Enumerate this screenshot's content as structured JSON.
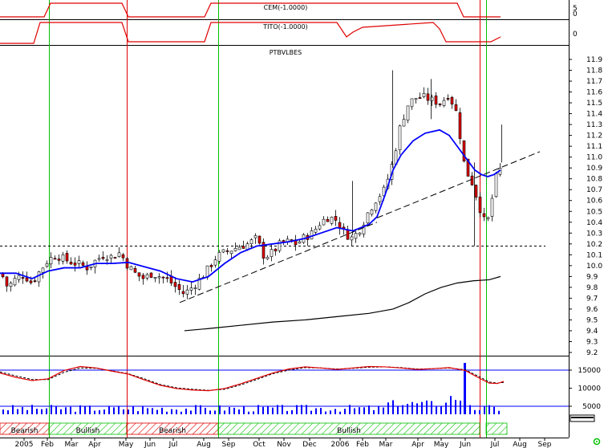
{
  "panels": {
    "cem_label": "CEM(-1.0000)",
    "tito_label": "TITO(-1.0000)",
    "price_label": "PTBVLBES",
    "cem_axis": [
      "5",
      "0"
    ],
    "tito_axis": [
      "0"
    ]
  },
  "zones": [
    {
      "label": "Bearish"
    },
    {
      "label": "Bullish"
    },
    {
      "label": "Bearish"
    },
    {
      "label": "Bullish"
    }
  ],
  "x_axis": {
    "months": [
      "2005",
      "Feb",
      "Mar",
      "Apr",
      "May",
      "Jun",
      "Jul",
      "Aug",
      "Sep",
      "Oct",
      "Nov",
      "Dec",
      "2006",
      "Feb",
      "Mar",
      "Apr",
      "May",
      "Jun",
      "Jul",
      "Aug",
      "Sep"
    ]
  },
  "colors": {
    "up_candle": "#ffffff",
    "down_candle": "#e00000",
    "ma_short": "#0000ff",
    "ma_long": "#000000",
    "bull_line": "#00c000",
    "bear_line": "#e00000",
    "volume": "#0000ff",
    "stoch_k": "#e00000",
    "stoch_d": "#000000",
    "status_icon": "#00c000"
  },
  "chart_data": {
    "type": "candlestick",
    "title": "PTBVLBES",
    "y_ticks": [
      "11.9",
      "11.8",
      "11.7",
      "11.6",
      "11.5",
      "11.4",
      "11.3",
      "11.2",
      "11.1",
      "11.0",
      "10.9",
      "10.8",
      "10.7",
      "10.6",
      "10.5",
      "10.4",
      "10.3",
      "10.2",
      "10.1",
      "10.0",
      "9.9",
      "9.8",
      "9.7",
      "9.6",
      "9.5",
      "9.4",
      "9.3",
      "9.2"
    ],
    "ylim": [
      9.15,
      11.95
    ],
    "volume_ticks": [
      "15000",
      "10000",
      "5000"
    ],
    "support_level": 10.18,
    "price_path": [
      [
        0,
        9.93
      ],
      [
        8,
        9.8
      ],
      [
        18,
        9.88
      ],
      [
        28,
        9.92
      ],
      [
        38,
        9.84
      ],
      [
        48,
        9.95
      ],
      [
        58,
        10.05
      ],
      [
        68,
        10.1
      ],
      [
        78,
        10.06
      ],
      [
        88,
        10.03
      ],
      [
        98,
        10.01
      ],
      [
        108,
        9.98
      ],
      [
        118,
        10.05
      ],
      [
        128,
        10.1
      ],
      [
        138,
        10.08
      ],
      [
        148,
        10.12
      ],
      [
        158,
        10.0
      ],
      [
        168,
        9.92
      ],
      [
        178,
        9.88
      ],
      [
        188,
        9.93
      ],
      [
        198,
        9.9
      ],
      [
        208,
        9.87
      ],
      [
        218,
        9.8
      ],
      [
        228,
        9.74
      ],
      [
        238,
        9.8
      ],
      [
        248,
        9.88
      ],
      [
        258,
        9.97
      ],
      [
        268,
        10.08
      ],
      [
        278,
        10.12
      ],
      [
        288,
        10.15
      ],
      [
        298,
        10.18
      ],
      [
        308,
        10.2
      ],
      [
        318,
        10.25
      ],
      [
        328,
        10.08
      ],
      [
        338,
        10.12
      ],
      [
        348,
        10.2
      ],
      [
        358,
        10.22
      ],
      [
        368,
        10.2
      ],
      [
        378,
        10.26
      ],
      [
        388,
        10.3
      ],
      [
        398,
        10.4
      ],
      [
        408,
        10.45
      ],
      [
        418,
        10.42
      ],
      [
        428,
        10.3
      ],
      [
        438,
        10.25
      ],
      [
        448,
        10.35
      ],
      [
        458,
        10.5
      ],
      [
        468,
        10.62
      ],
      [
        478,
        10.7
      ],
      [
        488,
        10.95
      ],
      [
        498,
        11.3
      ],
      [
        508,
        11.5
      ],
      [
        518,
        11.55
      ],
      [
        528,
        11.55
      ],
      [
        538,
        11.52
      ],
      [
        548,
        11.5
      ],
      [
        558,
        11.58
      ],
      [
        568,
        11.4
      ],
      [
        578,
        10.9
      ],
      [
        588,
        10.75
      ],
      [
        598,
        10.5
      ],
      [
        605,
        10.35
      ],
      [
        612,
        10.62
      ],
      [
        618,
        10.85
      ],
      [
        624,
        10.9
      ]
    ],
    "ma_short": [
      [
        0,
        9.93
      ],
      [
        20,
        9.93
      ],
      [
        40,
        9.88
      ],
      [
        60,
        9.95
      ],
      [
        80,
        9.98
      ],
      [
        100,
        9.98
      ],
      [
        120,
        10.02
      ],
      [
        140,
        10.02
      ],
      [
        160,
        10.03
      ],
      [
        180,
        9.99
      ],
      [
        200,
        9.95
      ],
      [
        220,
        9.88
      ],
      [
        240,
        9.85
      ],
      [
        260,
        9.9
      ],
      [
        280,
        10.02
      ],
      [
        300,
        10.12
      ],
      [
        320,
        10.18
      ],
      [
        340,
        10.2
      ],
      [
        360,
        10.22
      ],
      [
        380,
        10.25
      ],
      [
        400,
        10.3
      ],
      [
        420,
        10.35
      ],
      [
        440,
        10.32
      ],
      [
        460,
        10.38
      ],
      [
        470,
        10.45
      ],
      [
        480,
        10.65
      ],
      [
        490,
        10.88
      ],
      [
        500,
        11.02
      ],
      [
        515,
        11.15
      ],
      [
        530,
        11.22
      ],
      [
        548,
        11.25
      ],
      [
        560,
        11.2
      ],
      [
        572,
        11.08
      ],
      [
        582,
        10.98
      ],
      [
        592,
        10.88
      ],
      [
        600,
        10.84
      ],
      [
        608,
        10.82
      ],
      [
        616,
        10.84
      ],
      [
        624,
        10.88
      ]
    ],
    "ma_long": [
      [
        230,
        9.4
      ],
      [
        260,
        9.42
      ],
      [
        300,
        9.45
      ],
      [
        340,
        9.48
      ],
      [
        380,
        9.5
      ],
      [
        420,
        9.53
      ],
      [
        460,
        9.56
      ],
      [
        490,
        9.6
      ],
      [
        510,
        9.66
      ],
      [
        530,
        9.74
      ],
      [
        550,
        9.8
      ],
      [
        570,
        9.84
      ],
      [
        590,
        9.86
      ],
      [
        610,
        9.87
      ],
      [
        624,
        9.9
      ]
    ],
    "trendlines": [
      {
        "from": [
          224,
          9.66
        ],
        "to": [
          470,
          10.4
        ]
      },
      {
        "from": [
          470,
          10.44
        ],
        "to": [
          673,
          11.05
        ]
      }
    ],
    "volume": [],
    "stoch_k": [
      [
        0,
        14200
      ],
      [
        20,
        13000
      ],
      [
        40,
        12100
      ],
      [
        60,
        12600
      ],
      [
        80,
        14900
      ],
      [
        100,
        16000
      ],
      [
        120,
        15600
      ],
      [
        140,
        14700
      ],
      [
        160,
        13900
      ],
      [
        180,
        12300
      ],
      [
        200,
        10800
      ],
      [
        220,
        9900
      ],
      [
        240,
        9500
      ],
      [
        260,
        9300
      ],
      [
        280,
        9900
      ],
      [
        300,
        11200
      ],
      [
        320,
        12700
      ],
      [
        340,
        14200
      ],
      [
        360,
        15300
      ],
      [
        380,
        15900
      ],
      [
        400,
        15600
      ],
      [
        420,
        15200
      ],
      [
        440,
        15600
      ],
      [
        460,
        16000
      ],
      [
        480,
        15900
      ],
      [
        500,
        15600
      ],
      [
        520,
        15200
      ],
      [
        540,
        15400
      ],
      [
        560,
        15700
      ],
      [
        580,
        14900
      ],
      [
        600,
        12500
      ],
      [
        610,
        11400
      ],
      [
        620,
        11300
      ],
      [
        628,
        11900
      ]
    ],
    "stoch_d": [
      [
        0,
        14500
      ],
      [
        20,
        13400
      ],
      [
        40,
        12400
      ],
      [
        60,
        12400
      ],
      [
        80,
        14400
      ],
      [
        100,
        15600
      ],
      [
        120,
        15500
      ],
      [
        140,
        14800
      ],
      [
        160,
        14000
      ],
      [
        180,
        12600
      ],
      [
        200,
        11000
      ],
      [
        220,
        10100
      ],
      [
        240,
        9700
      ],
      [
        260,
        9400
      ],
      [
        280,
        9700
      ],
      [
        300,
        10900
      ],
      [
        320,
        12400
      ],
      [
        340,
        14000
      ],
      [
        360,
        15000
      ],
      [
        380,
        15700
      ],
      [
        400,
        15600
      ],
      [
        420,
        15300
      ],
      [
        440,
        15500
      ],
      [
        460,
        15800
      ],
      [
        480,
        15900
      ],
      [
        500,
        15700
      ],
      [
        520,
        15300
      ],
      [
        540,
        15400
      ],
      [
        560,
        15600
      ],
      [
        580,
        15100
      ],
      [
        600,
        12900
      ],
      [
        610,
        11700
      ],
      [
        620,
        11400
      ],
      [
        628,
        11600
      ]
    ],
    "signals": [
      {
        "type": "bull",
        "x": 61
      },
      {
        "type": "bear",
        "x": 158
      },
      {
        "type": "bull",
        "x": 272
      },
      {
        "type": "bear",
        "x": 598
      },
      {
        "type": "bull",
        "x": 606
      }
    ]
  }
}
